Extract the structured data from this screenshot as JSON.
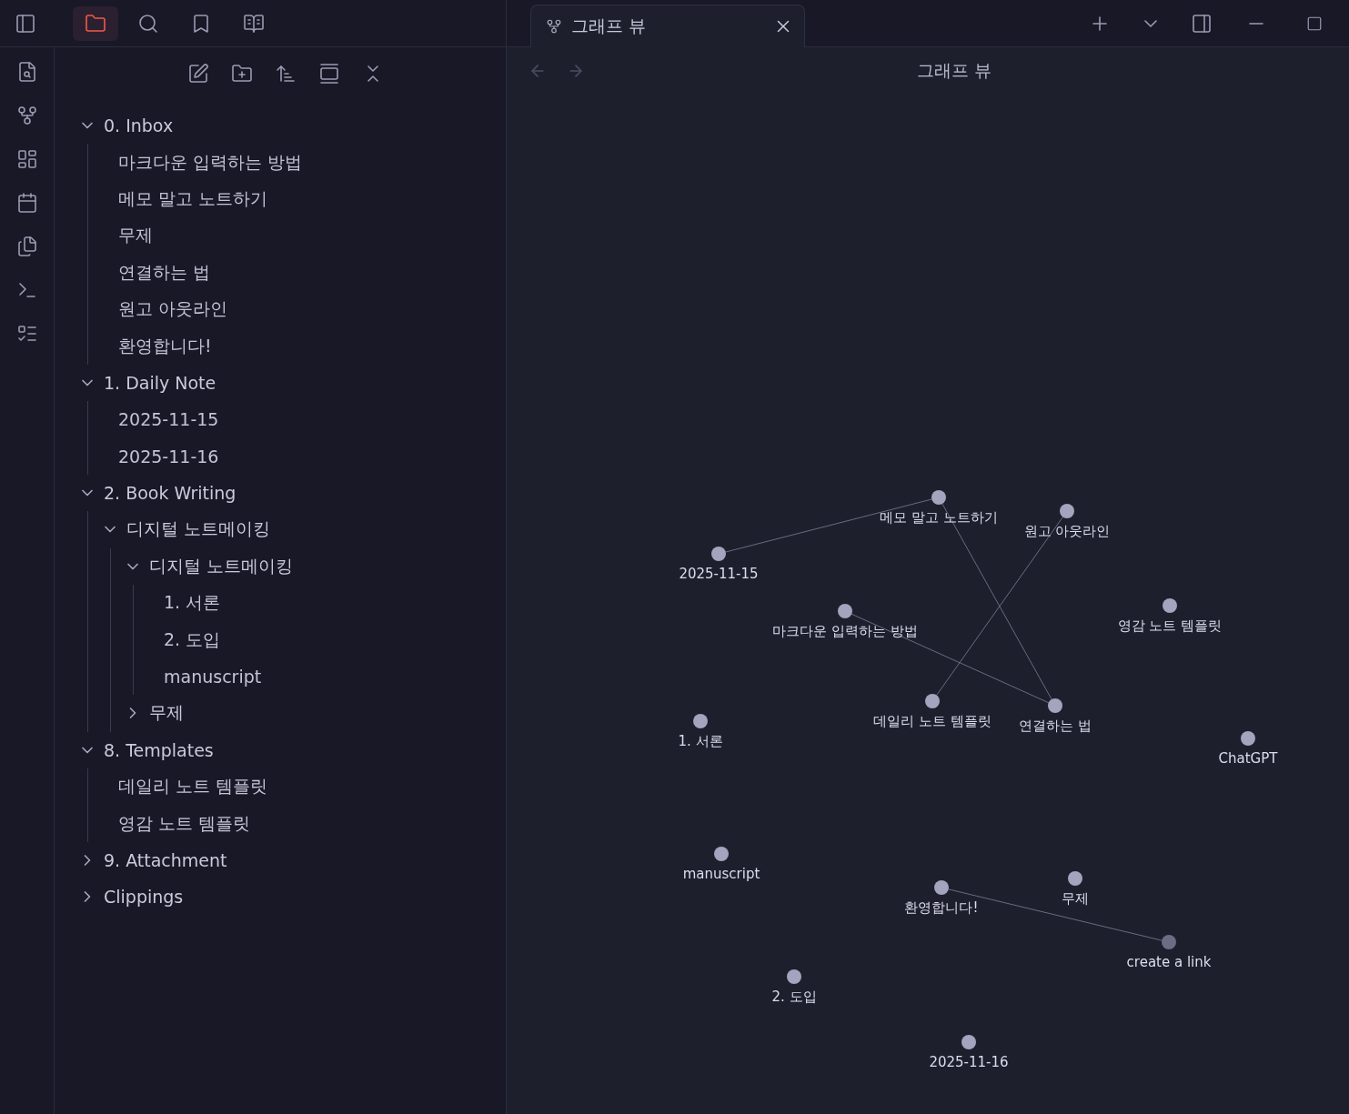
{
  "ribbon_top": [
    {
      "selected": true
    },
    {
      "selected": false
    },
    {
      "selected": false
    },
    {
      "selected": false
    }
  ],
  "tab": {
    "title": "그래프 뷰",
    "selected": true
  },
  "view_header": {
    "title": "그래프 뷰"
  },
  "file_tree": [
    {
      "label": "0. Inbox",
      "kind": "folder",
      "expanded": true,
      "children": [
        {
          "label": "마크다운 입력하는 방법",
          "kind": "file"
        },
        {
          "label": "메모 말고 노트하기",
          "kind": "file"
        },
        {
          "label": "무제",
          "kind": "file"
        },
        {
          "label": "연결하는 법",
          "kind": "file"
        },
        {
          "label": "원고 아웃라인",
          "kind": "file"
        },
        {
          "label": "환영합니다!",
          "kind": "file"
        }
      ]
    },
    {
      "label": "1. Daily Note",
      "kind": "folder",
      "expanded": true,
      "children": [
        {
          "label": "2025-11-15",
          "kind": "file"
        },
        {
          "label": "2025-11-16",
          "kind": "file"
        }
      ]
    },
    {
      "label": "2. Book Writing",
      "kind": "folder",
      "expanded": true,
      "children": [
        {
          "label": "디지털 노트메이킹",
          "kind": "folder",
          "expanded": true,
          "children": [
            {
              "label": "디지털 노트메이킹",
              "kind": "folder",
              "expanded": true,
              "children": [
                {
                  "label": "1. 서론",
                  "kind": "file"
                },
                {
                  "label": "2. 도입",
                  "kind": "file"
                },
                {
                  "label": "manuscript",
                  "kind": "file"
                }
              ]
            },
            {
              "label": "무제",
              "kind": "folder",
              "expanded": false
            }
          ]
        }
      ]
    },
    {
      "label": "8. Templates",
      "kind": "folder",
      "expanded": true,
      "children": [
        {
          "label": "데일리 노트 템플릿",
          "kind": "file"
        },
        {
          "label": "영감 노트 템플릿",
          "kind": "file"
        }
      ]
    },
    {
      "label": "9. Attachment",
      "kind": "folder",
      "expanded": false
    },
    {
      "label": "Clippings",
      "kind": "folder",
      "expanded": false
    }
  ],
  "graph": {
    "nodes": [
      {
        "label": "메모 말고 노트하기",
        "kind": "note"
      },
      {
        "label": "원고 아웃라인",
        "kind": "note"
      },
      {
        "label": "2025-11-15",
        "kind": "note"
      },
      {
        "label": "마크다운 입력하는 방법",
        "kind": "note"
      },
      {
        "label": "영감 노트 템플릿",
        "kind": "note"
      },
      {
        "label": "데일리 노트 템플릿",
        "kind": "note"
      },
      {
        "label": "연결하는 법",
        "kind": "note"
      },
      {
        "label": "1. 서론",
        "kind": "note"
      },
      {
        "label": "ChatGPT",
        "kind": "note"
      },
      {
        "label": "manuscript",
        "kind": "note"
      },
      {
        "label": "환영합니다!",
        "kind": "note"
      },
      {
        "label": "무제",
        "kind": "note"
      },
      {
        "label": "create a link",
        "kind": "unresolved"
      },
      {
        "label": "2. 도입",
        "kind": "note"
      },
      {
        "label": "2025-11-16",
        "kind": "note"
      }
    ]
  }
}
